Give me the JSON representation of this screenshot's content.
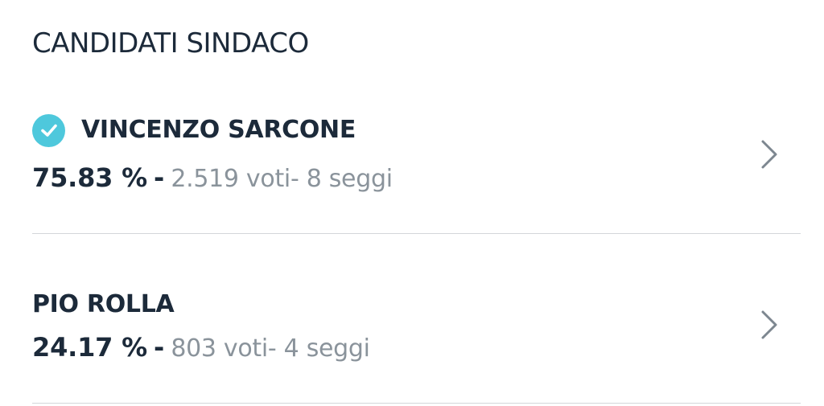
{
  "section": {
    "title": "CANDIDATI SINDACO"
  },
  "candidates": [
    {
      "name": "VINCENZO SARCONE",
      "elected": true,
      "percentage": "75.83 %",
      "separator": "-",
      "details": "2.519 voti- 8 seggi",
      "icon": "check-circle-icon"
    },
    {
      "name": "PIO ROLLA",
      "elected": false,
      "percentage": "24.17 %",
      "separator": "-",
      "details": "803 voti- 4 seggi",
      "icon": null
    }
  ],
  "colors": {
    "text_primary": "#1c2a3a",
    "text_secondary": "#8a939b",
    "accent_check": "#4ec8dc",
    "divider": "#d3d6da",
    "chevron": "#7d8790"
  }
}
